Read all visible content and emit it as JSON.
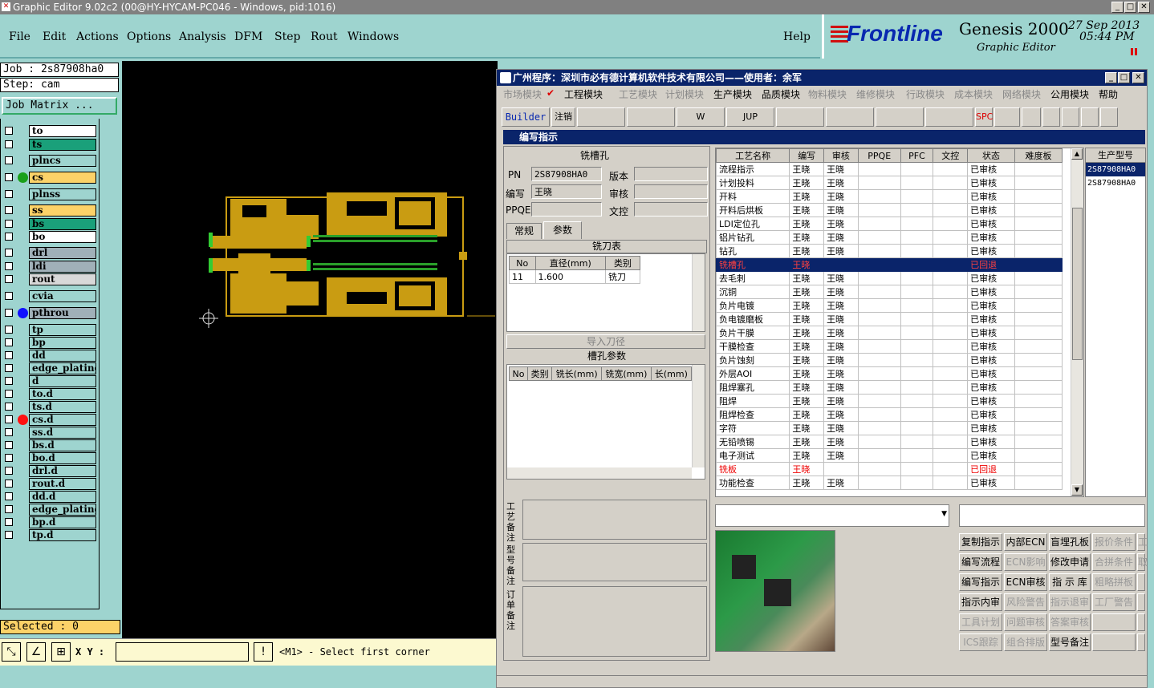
{
  "window": {
    "title": "Graphic Editor 9.02c2 (00@HY-HYCAM-PC046 - Windows, pid:1016)"
  },
  "menu": [
    "File",
    "Edit",
    "Actions",
    "Options",
    "Analysis",
    "DFM",
    "Step",
    "Rout",
    "Windows"
  ],
  "help": "Help",
  "brand": {
    "logo": "Frontline",
    "product": "Genesis 2000",
    "subtitle": "Graphic Editor",
    "date": "27 Sep 2013",
    "time": "05:44 PM"
  },
  "job": {
    "job_label": "Job : 2s87908ha0",
    "step_label": "Step: cam",
    "matrix_button": "Job Matrix ..."
  },
  "layers": [
    {
      "name": "to",
      "bg": "#ffffff"
    },
    {
      "name": "ts",
      "bg": "#1aa07a"
    },
    {
      "name": "plncs",
      "bg": "#9ed4cf"
    },
    {
      "name": "cs",
      "bg": "#fcd268",
      "dot": "#1aa01a"
    },
    {
      "name": "plnss",
      "bg": "#9ed4cf"
    },
    {
      "name": "ss",
      "bg": "#fcd268"
    },
    {
      "name": "bs",
      "bg": "#1aa07a"
    },
    {
      "name": "bo",
      "bg": "#ffffff"
    },
    {
      "name": "drl",
      "bg": "#a0b0b8"
    },
    {
      "name": "ldi",
      "bg": "#a0b0b8"
    },
    {
      "name": "rout",
      "bg": "#d8d8d8"
    },
    {
      "name": "cvia",
      "bg": "#9ed4cf"
    },
    {
      "name": "pthrou",
      "bg": "#a0b0b8",
      "dot": "#1010ff"
    },
    {
      "name": "tp",
      "bg": "#9ed4cf"
    },
    {
      "name": "bp",
      "bg": "#9ed4cf"
    },
    {
      "name": "dd",
      "bg": "#9ed4cf"
    },
    {
      "name": "edge_plating",
      "bg": "#9ed4cf"
    },
    {
      "name": "d",
      "bg": "#9ed4cf"
    },
    {
      "name": "to.d",
      "bg": "#9ed4cf"
    },
    {
      "name": "ts.d",
      "bg": "#9ed4cf"
    },
    {
      "name": "cs.d",
      "bg": "#9ed4cf",
      "dot": "#ff1010"
    },
    {
      "name": "ss.d",
      "bg": "#9ed4cf"
    },
    {
      "name": "bs.d",
      "bg": "#9ed4cf"
    },
    {
      "name": "bo.d",
      "bg": "#9ed4cf"
    },
    {
      "name": "drl.d",
      "bg": "#9ed4cf"
    },
    {
      "name": "rout.d",
      "bg": "#9ed4cf"
    },
    {
      "name": "dd.d",
      "bg": "#9ed4cf"
    },
    {
      "name": "edge_plating.d",
      "bg": "#9ed4cf"
    },
    {
      "name": "bp.d",
      "bg": "#9ed4cf"
    },
    {
      "name": "tp.d",
      "bg": "#9ed4cf"
    }
  ],
  "status": {
    "selected": "Selected : 0",
    "xy_label": "X Y :",
    "xy_value": "",
    "prompt": "<M1> - Select first corner"
  },
  "dialog": {
    "title": "广州程序：深圳市必有德计算机软件技术有限公司——使用者：余军",
    "modules": [
      "市场模块",
      "工程模块",
      "工艺模块",
      "计划模块",
      "生产模块",
      "品质模块",
      "物料模块",
      "维修模块",
      "行政模块",
      "成本模块",
      "网络模块",
      "公用模块",
      "帮助"
    ],
    "toolbar": [
      "Builder",
      "注销",
      "",
      "",
      "W",
      "JUP",
      "",
      "",
      "",
      "",
      "SPC",
      "",
      "",
      "",
      "",
      "",
      ""
    ],
    "subtitle": "编写指示",
    "section": "铣槽孔",
    "pn_label": "PN",
    "pn_value": "2S87908HA0",
    "version_label": "版本",
    "version_value": "",
    "author_label": "编写",
    "author_value": "王晓",
    "review_label": "审核",
    "review_value": "",
    "ppqe_label": "PPQE",
    "ppqe_value": "",
    "doc_label": "文控",
    "doc_value": "",
    "tabs": [
      "常规",
      "参数"
    ],
    "tool_table_title": "铣刀表",
    "tool_headers": [
      "No",
      "直径(mm)",
      "类别"
    ],
    "tool_rows": [
      [
        "11",
        "1.600",
        "铣刀"
      ]
    ],
    "import_button": "导入刀径",
    "slot_title": "槽孔参数",
    "slot_headers": [
      "No",
      "类别",
      "铣长(mm)",
      "铣宽(mm)",
      "长(mm)"
    ],
    "note_labels": [
      "工艺备注",
      "型号备注",
      "订单备注"
    ],
    "process_headers": [
      "工艺名称",
      "编写",
      "审核",
      "PPQE",
      "PFC",
      "文控",
      "状态",
      "难度板"
    ],
    "process_rows": [
      [
        "流程指示",
        "王晓",
        "王晓",
        "",
        "",
        "",
        "已审核",
        ""
      ],
      [
        "计划投料",
        "王晓",
        "王晓",
        "",
        "",
        "",
        "已审核",
        ""
      ],
      [
        "开料",
        "王晓",
        "王晓",
        "",
        "",
        "",
        "已审核",
        ""
      ],
      [
        "开料后烘板",
        "王晓",
        "王晓",
        "",
        "",
        "",
        "已审核",
        ""
      ],
      [
        "LDI定位孔",
        "王晓",
        "王晓",
        "",
        "",
        "",
        "已审核",
        ""
      ],
      [
        "铝片钻孔",
        "王晓",
        "王晓",
        "",
        "",
        "",
        "已审核",
        ""
      ],
      [
        "钻孔",
        "王晓",
        "王晓",
        "",
        "",
        "",
        "已审核",
        ""
      ],
      [
        "铣槽孔",
        "王晓",
        "",
        "",
        "",
        "",
        "已回退",
        ""
      ],
      [
        "去毛刺",
        "王晓",
        "王晓",
        "",
        "",
        "",
        "已审核",
        ""
      ],
      [
        "沉铜",
        "王晓",
        "王晓",
        "",
        "",
        "",
        "已审核",
        ""
      ],
      [
        "负片电镀",
        "王晓",
        "王晓",
        "",
        "",
        "",
        "已审核",
        ""
      ],
      [
        "负电镀磨板",
        "王晓",
        "王晓",
        "",
        "",
        "",
        "已审核",
        ""
      ],
      [
        "负片干膜",
        "王晓",
        "王晓",
        "",
        "",
        "",
        "已审核",
        ""
      ],
      [
        "干膜检查",
        "王晓",
        "王晓",
        "",
        "",
        "",
        "已审核",
        ""
      ],
      [
        "负片蚀刻",
        "王晓",
        "王晓",
        "",
        "",
        "",
        "已审核",
        ""
      ],
      [
        "外层AOI",
        "王晓",
        "王晓",
        "",
        "",
        "",
        "已审核",
        ""
      ],
      [
        "阻焊塞孔",
        "王晓",
        "王晓",
        "",
        "",
        "",
        "已审核",
        ""
      ],
      [
        "阻焊",
        "王晓",
        "王晓",
        "",
        "",
        "",
        "已审核",
        ""
      ],
      [
        "阻焊检查",
        "王晓",
        "王晓",
        "",
        "",
        "",
        "已审核",
        ""
      ],
      [
        "字符",
        "王晓",
        "王晓",
        "",
        "",
        "",
        "已审核",
        ""
      ],
      [
        "无铅喷锡",
        "王晓",
        "王晓",
        "",
        "",
        "",
        "已审核",
        ""
      ],
      [
        "电子测试",
        "王晓",
        "王晓",
        "",
        "",
        "",
        "已审核",
        ""
      ],
      [
        "铣板",
        "王晓",
        "",
        "",
        "",
        "",
        "已回退",
        ""
      ],
      [
        "功能检查",
        "王晓",
        "王晓",
        "",
        "",
        "",
        "已审核",
        ""
      ]
    ],
    "model_header": "生产型号",
    "models": [
      "2S87908HA0",
      "2S87908HA0"
    ],
    "action_buttons": [
      [
        "复制指示",
        "内部ECN",
        "盲埋孔板",
        "报价条件",
        "工"
      ],
      [
        "编写流程",
        "ECN影响",
        "修改申请",
        "合拼条件",
        "取"
      ],
      [
        "编写指示",
        "ECN审核",
        "指 示 库",
        "粗略拼板",
        ""
      ],
      [
        "指示内审",
        "风险警告",
        "指示退审",
        "工厂警告",
        ""
      ],
      [
        "工具计划",
        "问题审核",
        "答案审核",
        "",
        ""
      ],
      [
        "ICS跟踪",
        "组合排版",
        "型号备注",
        "",
        ""
      ]
    ]
  }
}
